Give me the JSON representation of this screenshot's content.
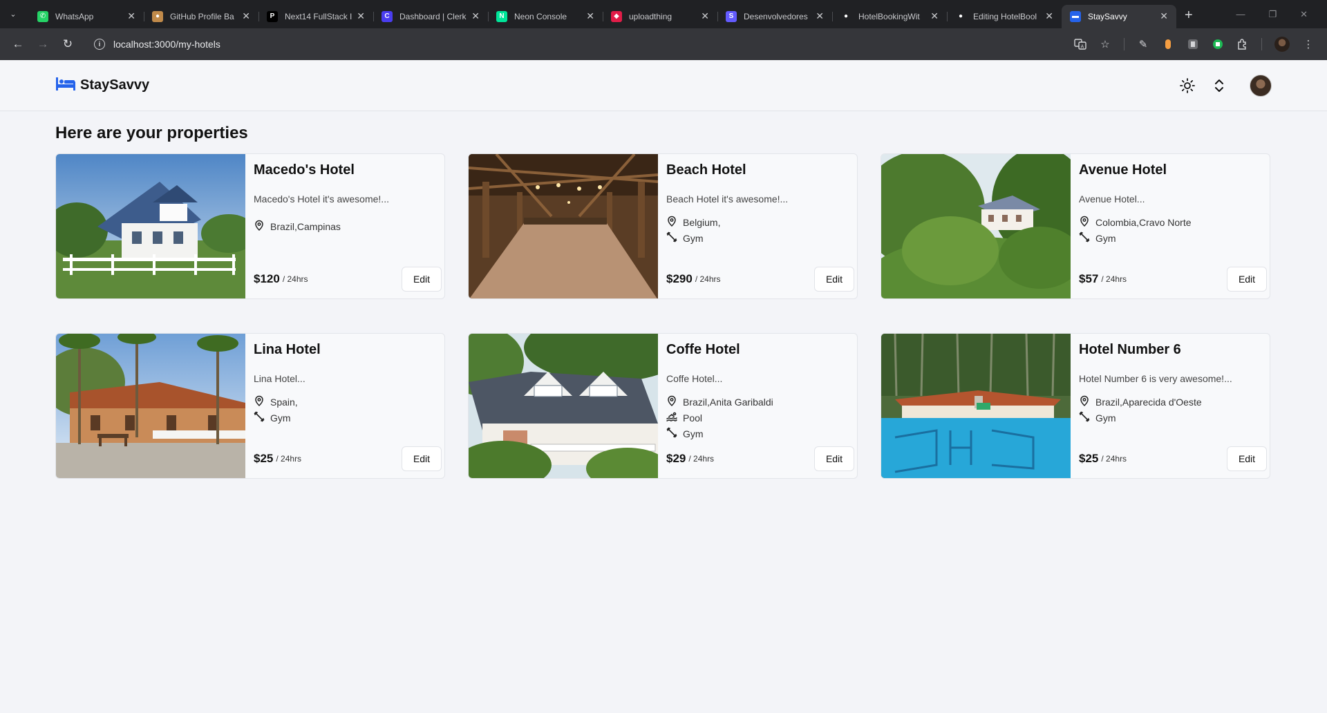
{
  "browser": {
    "tabs": [
      {
        "title": "WhatsApp",
        "fav_color": "#25d366",
        "fav_glyph": "✆",
        "active": false
      },
      {
        "title": "GitHub Profile Ba",
        "fav_color": "#c08a4a",
        "fav_glyph": "●",
        "active": false
      },
      {
        "title": "Next14 FullStack I",
        "fav_color": "#000000",
        "fav_glyph": "P",
        "active": false
      },
      {
        "title": "Dashboard | Clerk",
        "fav_color": "#4a3df0",
        "fav_glyph": "C",
        "active": false
      },
      {
        "title": "Neon Console",
        "fav_color": "#00e599",
        "fav_glyph": "N",
        "active": false
      },
      {
        "title": "uploadthing",
        "fav_color": "#e11d48",
        "fav_glyph": "◆",
        "active": false
      },
      {
        "title": "Desenvolvedores",
        "fav_color": "#635bff",
        "fav_glyph": "S",
        "active": false
      },
      {
        "title": "HotelBookingWit",
        "fav_color": "#ffffff",
        "fav_glyph": "●",
        "active": false
      },
      {
        "title": "Editing HotelBool",
        "fav_color": "#ffffff",
        "fav_glyph": "●",
        "active": false
      },
      {
        "title": "StaySavvy",
        "fav_color": "#2563eb",
        "fav_glyph": "▬",
        "active": true
      }
    ],
    "url": "localhost:3000/my-hotels"
  },
  "app": {
    "brand": "StaySavvy",
    "brand_color": "#2563eb"
  },
  "page": {
    "title": "Here are your properties"
  },
  "hotels": [
    {
      "name": "Macedo's Hotel",
      "desc": "Macedo's Hotel it's awesome!...",
      "location": "Brazil,Campinas",
      "amenities": [],
      "price": "$120",
      "per": "/ 24hrs",
      "edit": "Edit",
      "scene": "cottage"
    },
    {
      "name": "Beach Hotel",
      "desc": "Beach Hotel it's awesome!...",
      "location": "Belgium,",
      "amenities": [
        "Gym"
      ],
      "price": "$290",
      "per": "/ 24hrs",
      "edit": "Edit",
      "scene": "hall"
    },
    {
      "name": "Avenue Hotel",
      "desc": "Avenue Hotel...",
      "location": "Colombia,Cravo Norte",
      "amenities": [
        "Gym"
      ],
      "price": "$57",
      "per": "/ 24hrs",
      "edit": "Edit",
      "scene": "forest"
    },
    {
      "name": "Lina Hotel",
      "desc": "Lina Hotel...",
      "location": "Spain,",
      "amenities": [
        "Gym"
      ],
      "price": "$25",
      "per": "/ 24hrs",
      "edit": "Edit",
      "scene": "ranch"
    },
    {
      "name": "Coffe Hotel",
      "desc": "Coffe Hotel...",
      "location": "Brazil,Anita Garibaldi",
      "amenities": [
        "Pool",
        "Gym"
      ],
      "price": "$29",
      "per": "/ 24hrs",
      "edit": "Edit",
      "scene": "chalet"
    },
    {
      "name": "Hotel Number 6",
      "desc": "Hotel Number 6 is very awesome!...",
      "location": "Brazil,Aparecida d'Oeste",
      "amenities": [
        "Gym"
      ],
      "price": "$25",
      "per": "/ 24hrs",
      "edit": "Edit",
      "scene": "pool"
    }
  ]
}
